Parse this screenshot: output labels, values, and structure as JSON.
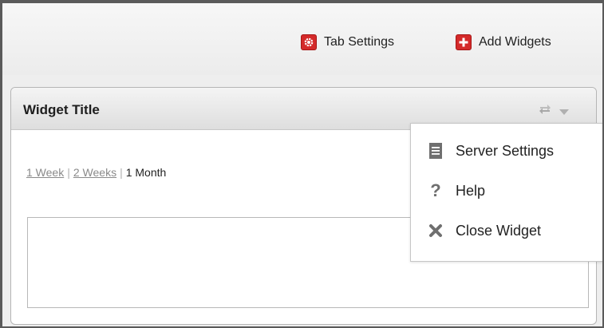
{
  "toolbar": {
    "tab_settings": {
      "label": "Tab Settings",
      "icon": "gear-icon"
    },
    "add_widgets": {
      "label": "Add Widgets",
      "icon": "plus-icon"
    },
    "accent_color": "#d42a2a"
  },
  "widget": {
    "title": "Widget Title",
    "header_icons": [
      "refresh-icon",
      "chevron-down-icon"
    ],
    "time_ranges": {
      "week": "1 Week",
      "two_weeks": "2 Weeks",
      "month": "1 Month",
      "separator": "|",
      "selected": "1 Month"
    }
  },
  "menu": {
    "items": [
      {
        "label": "Server Settings",
        "icon": "server-icon"
      },
      {
        "label": "Help",
        "icon": "help-icon"
      },
      {
        "label": "Close Widget",
        "icon": "close-icon"
      }
    ]
  }
}
